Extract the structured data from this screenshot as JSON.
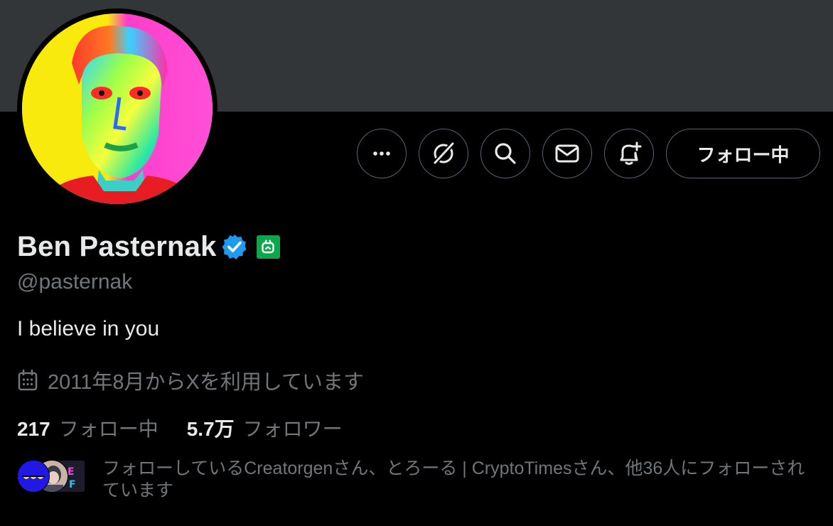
{
  "profile": {
    "display_name": "Ben Pasternak",
    "handle": "@pasternak",
    "bio": "I believe in you",
    "joined": "2011年8月からXを利用しています",
    "verified": true
  },
  "actions": {
    "more_icon": "more-dots-icon",
    "grok_icon": "grok-icon",
    "search_icon": "search-icon",
    "message_icon": "envelope-icon",
    "notify_icon": "bell-plus-icon",
    "follow_label": "フォロー中"
  },
  "stats": {
    "following_count": "217",
    "following_label": "フォロー中",
    "followers_count": "5.7万",
    "followers_label": "フォロワー"
  },
  "followed_by": {
    "text": "フォローしているCreatorgenさん、とろーる | CryptoTimesさん、他36人にフォローされています"
  },
  "colors": {
    "background": "#000000",
    "banner": "#333639",
    "verified": "#1d9bf0",
    "label_badge": "#0ba84a",
    "muted_text": "#71767b",
    "text": "#e7e9ea"
  }
}
